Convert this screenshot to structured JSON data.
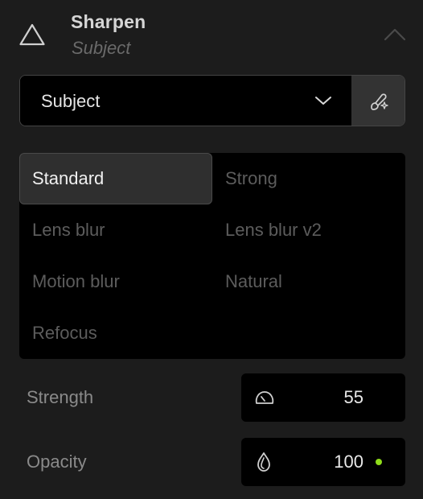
{
  "header": {
    "title": "Sharpen",
    "subtitle": "Subject",
    "icon": "triangle-icon",
    "collapse_icon": "chevron-up-icon"
  },
  "subject_select": {
    "value": "Subject",
    "chevron_icon": "chevron-down-icon",
    "tool_icon": "mask-brush-sparkle-icon"
  },
  "models": {
    "selected": "Standard",
    "items": [
      {
        "label": "Standard",
        "active": true
      },
      {
        "label": "Strong",
        "active": false
      },
      {
        "label": "Lens blur",
        "active": false
      },
      {
        "label": "Lens blur v2",
        "active": false
      },
      {
        "label": "Motion blur",
        "active": false
      },
      {
        "label": "Natural",
        "active": false
      },
      {
        "label": "Refocus",
        "active": false
      }
    ]
  },
  "params": {
    "strength": {
      "label": "Strength",
      "value": "55",
      "icon": "gauge-icon"
    },
    "opacity": {
      "label": "Opacity",
      "value": "100",
      "icon": "drop-icon",
      "indicator_color": "#8fdc1a"
    }
  },
  "colors": {
    "background": "#1c1c1c",
    "panel_dark": "#000000",
    "active_option": "#2f2f2f",
    "accent_green": "#8fdc1a"
  }
}
